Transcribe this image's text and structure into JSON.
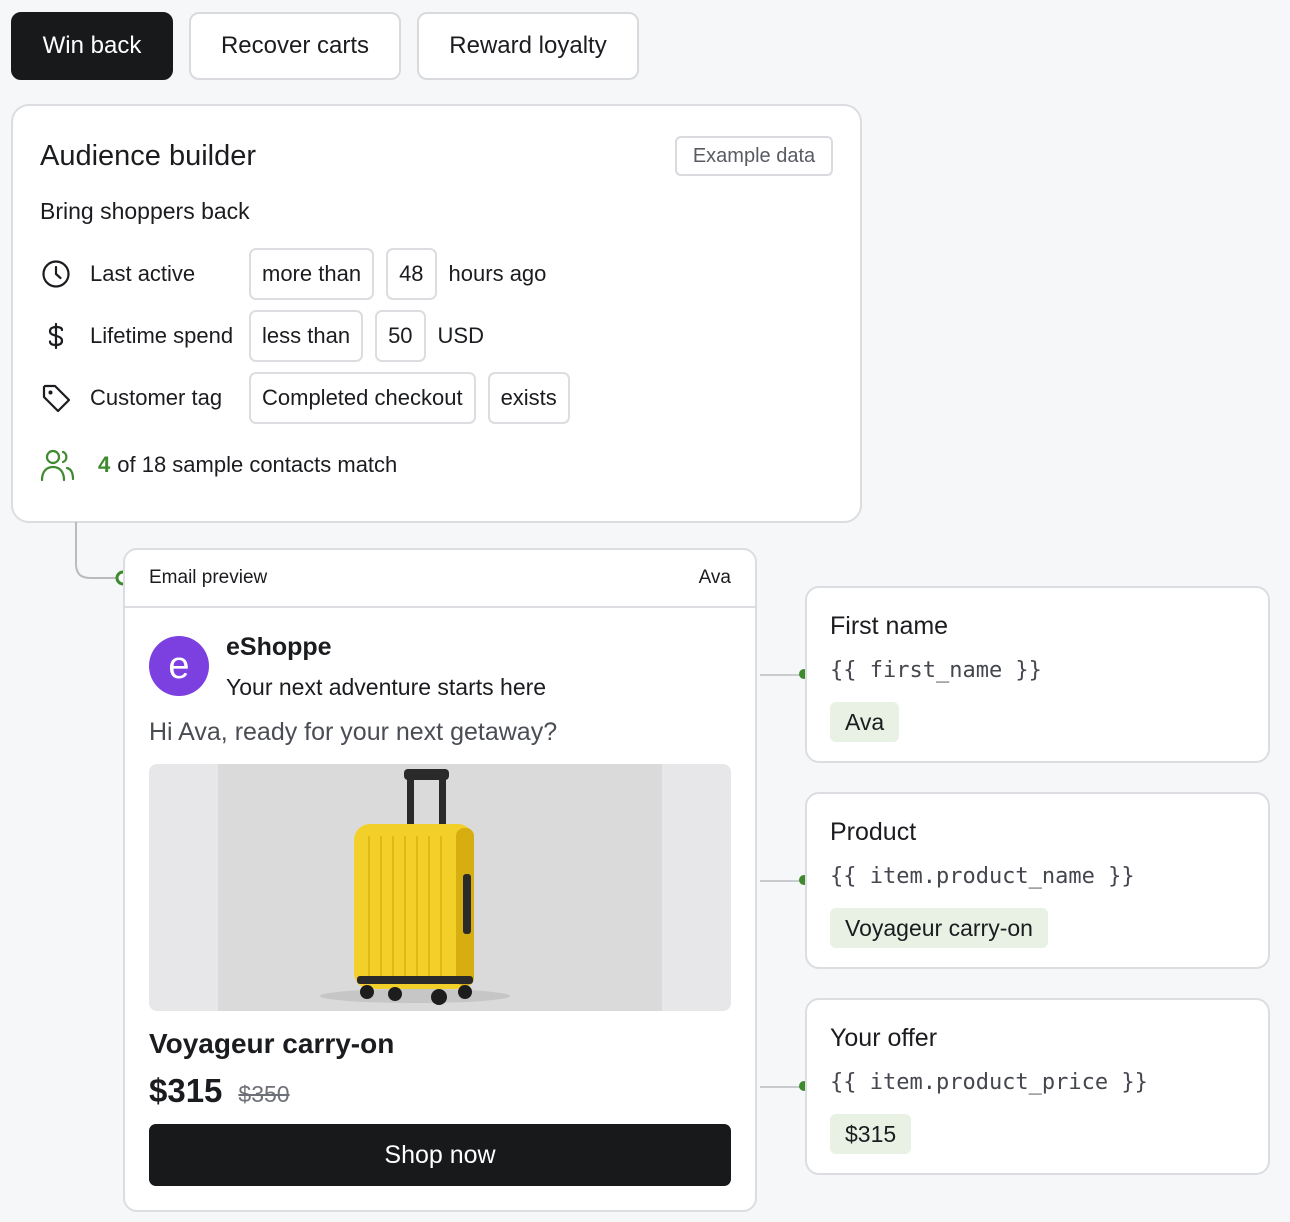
{
  "tabs": [
    {
      "label": "Win back",
      "active": true
    },
    {
      "label": "Recover carts",
      "active": false
    },
    {
      "label": "Reward loyalty",
      "active": false
    }
  ],
  "audience": {
    "title": "Audience builder",
    "badge": "Example data",
    "subtitle": "Bring shoppers back",
    "rules": [
      {
        "icon": "clock-icon",
        "label": "Last active",
        "operator": "more than",
        "value": "48",
        "unit": "hours ago"
      },
      {
        "icon": "dollar-icon",
        "label": "Lifetime spend",
        "operator": "less than",
        "value": "50",
        "unit": "USD"
      },
      {
        "icon": "tag-icon",
        "label": "Customer tag",
        "operator": "Completed checkout",
        "value": "exists"
      }
    ],
    "match_count": "4",
    "match_text": "of 18 sample contacts match"
  },
  "email": {
    "header_label": "Email preview",
    "recipient": "Ava",
    "avatar_letter": "e",
    "brand": "eShoppe",
    "tagline": "Your next adventure starts here",
    "greeting": "Hi Ava, ready for your next getaway?",
    "product_name": "Voyageur carry-on",
    "price": "$315",
    "old_price": "$350",
    "cta": "Shop now"
  },
  "variables": [
    {
      "title": "First name",
      "code": "{{ first_name }}",
      "value": "Ava"
    },
    {
      "title": "Product",
      "code": "{{ item.product_name }}",
      "value": "Voyageur carry-on"
    },
    {
      "title": "Your offer",
      "code": "{{ item.product_price }}",
      "value": "$315"
    }
  ],
  "colors": {
    "accent_green": "#3e8a2e",
    "avatar_purple": "#7c3fe0",
    "dark": "#18191b",
    "suitcase_yellow": "#f3cf2a"
  }
}
